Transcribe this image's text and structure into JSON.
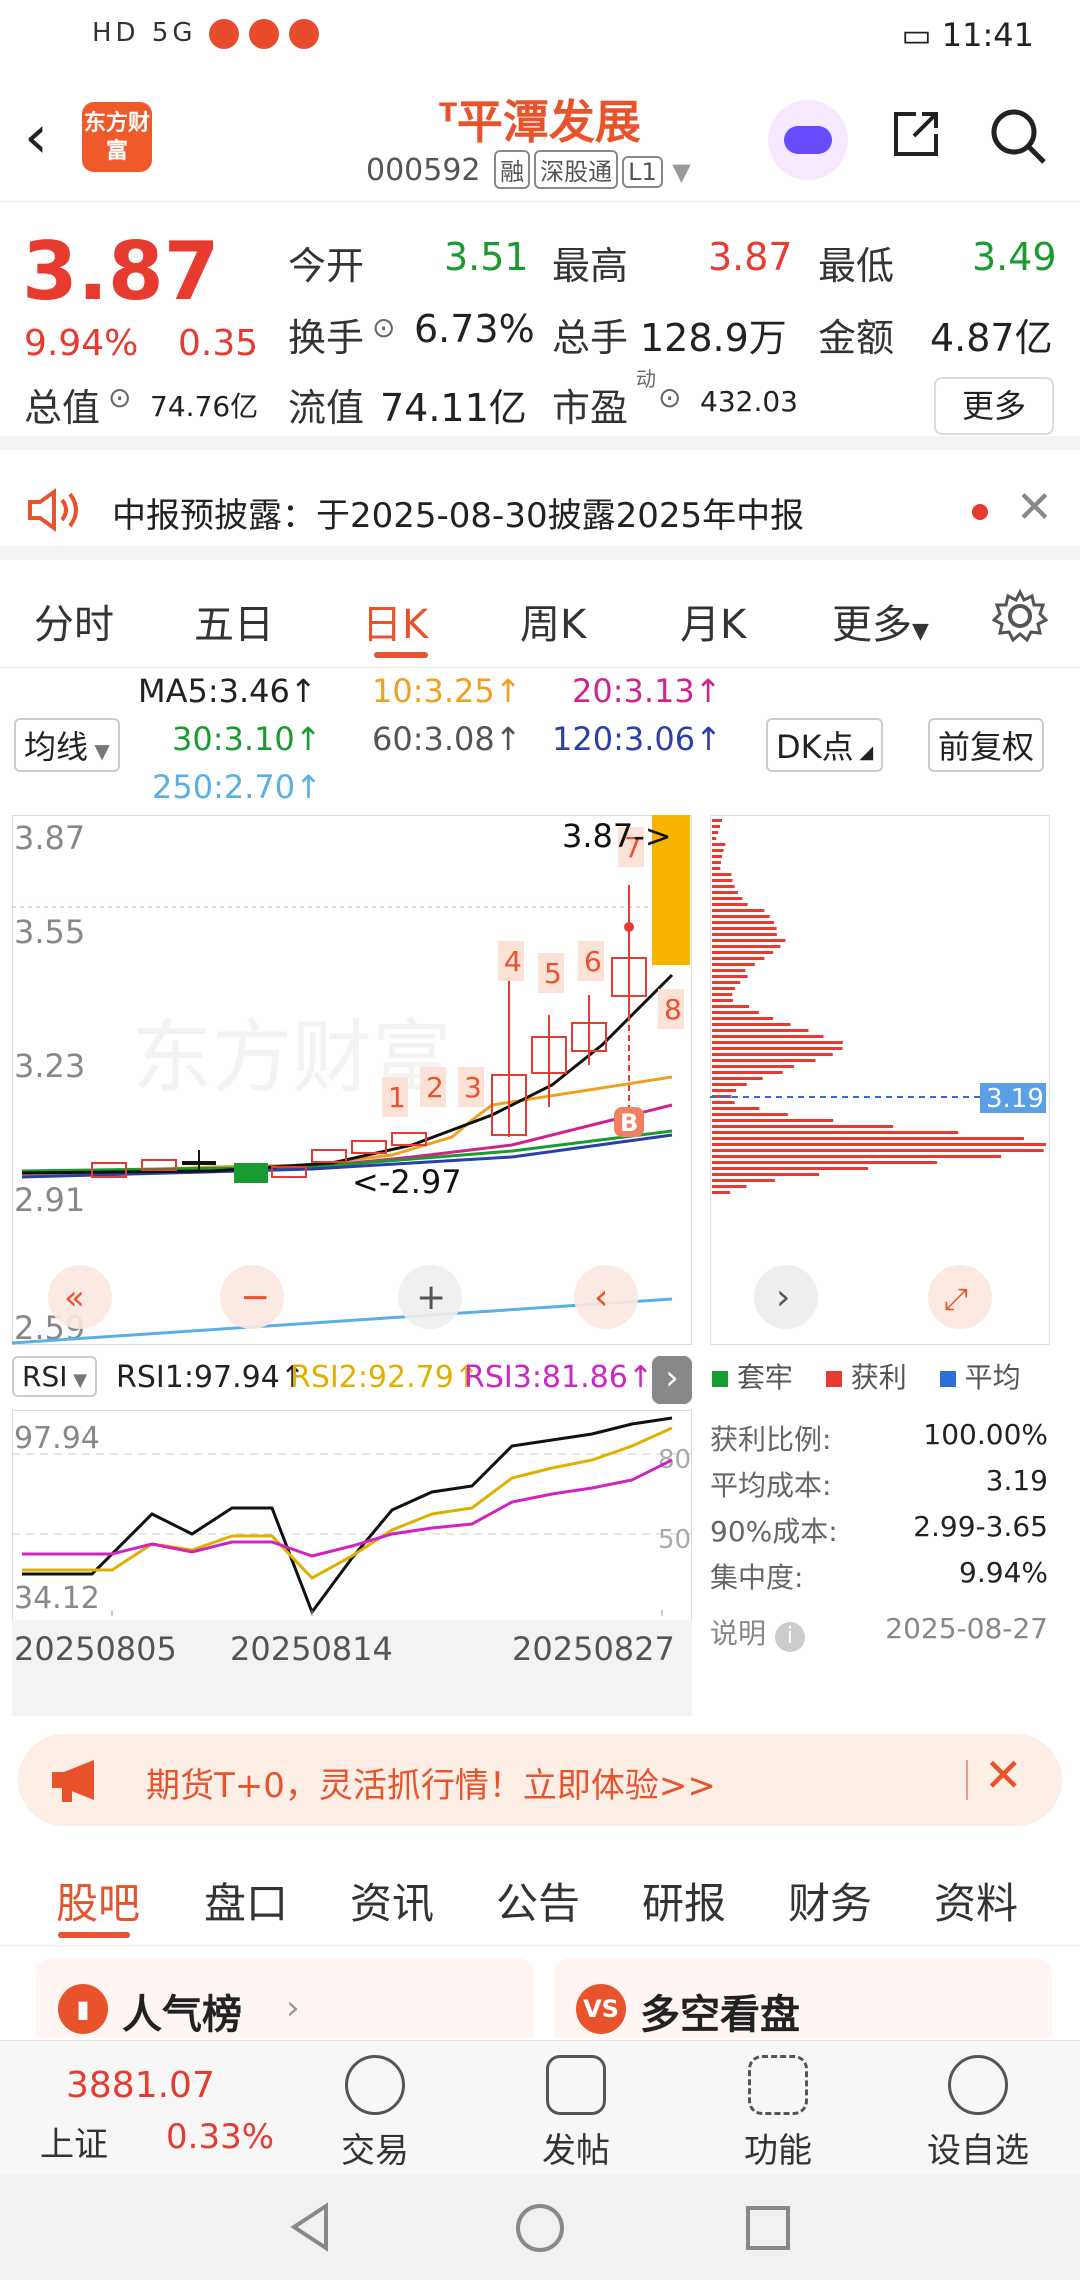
{
  "status_bar": {
    "left_text": "HD 5G",
    "time": "11:41"
  },
  "header": {
    "logo": "东方财富",
    "title_prefix": "T",
    "title": "平潭发展",
    "code": "000592",
    "tags": [
      "融",
      "深股通",
      "L1"
    ]
  },
  "quote": {
    "price": "3.87",
    "pct": "9.94%",
    "change": "0.35",
    "rows": [
      [
        {
          "label": "今开",
          "value": "3.51",
          "color": "green"
        },
        {
          "label": "最高",
          "value": "3.87",
          "color": "red"
        },
        {
          "label": "最低",
          "value": "3.49",
          "color": "green"
        }
      ],
      [
        {
          "label": "换手",
          "value": "6.73%",
          "color": "black"
        },
        {
          "label": "总手",
          "value": "128.9万",
          "color": "black"
        },
        {
          "label": "金额",
          "value": "4.87亿",
          "color": "black"
        }
      ]
    ],
    "total_value_label": "总值",
    "total_value": "74.76亿",
    "float_value_label": "流值",
    "float_value": "74.11亿",
    "pe_label": "市盈",
    "pe_sup": "动",
    "pe_value": "432.03",
    "more": "更多"
  },
  "notice": {
    "text": "中报预披露：于2025-08-30披露2025年中报"
  },
  "periods": {
    "tabs": [
      "分时",
      "五日",
      "日K",
      "周K",
      "月K",
      "更多"
    ],
    "active": "日K"
  },
  "ma": {
    "selector": "均线",
    "items": [
      {
        "text": "MA5:3.46↑",
        "color": "#222222"
      },
      {
        "text": "10:3.25↑",
        "color": "#f0a020"
      },
      {
        "text": "20:3.13↑",
        "color": "#d0248c"
      },
      {
        "text": "30:3.10↑",
        "color": "#1a9b2f"
      },
      {
        "text": "60:3.08↑",
        "color": "#555555"
      },
      {
        "text": "120:3.06↑",
        "color": "#2a3fa8"
      },
      {
        "text": "250:2.70↑",
        "color": "#5ab0e6"
      }
    ],
    "dk_button": "DK点",
    "adjust_button": "前复权"
  },
  "kline": {
    "y_labels": [
      "3.87",
      "3.55",
      "3.23",
      "2.91",
      "2.59"
    ],
    "high_marker": "3.87->",
    "low_marker": "<-2.97",
    "watermark": "东方财富",
    "signals": [
      "1",
      "2",
      "3",
      "4",
      "5",
      "6",
      "7",
      "8"
    ],
    "buy_marker": "B"
  },
  "volume_profile": {
    "avg_line_label": "3.19"
  },
  "rsi": {
    "selector": "RSI",
    "rsi1": "RSI1:97.94↑",
    "rsi2": "RSI2:92.79↑",
    "rsi3": "RSI3:81.86↑",
    "top_label": "97.94",
    "bottom_label": "34.12",
    "line80": "80",
    "line50": "50",
    "dates": [
      "20250805",
      "20250814",
      "20250827"
    ]
  },
  "cost": {
    "legend": [
      {
        "label": "套牢",
        "color": "#1a9b2f"
      },
      {
        "label": "获利",
        "color": "#e63b2e"
      },
      {
        "label": "平均",
        "color": "#2a6fd8"
      }
    ],
    "rows": [
      {
        "label": "获利比例:",
        "value": "100.00%"
      },
      {
        "label": "平均成本:",
        "value": "3.19"
      },
      {
        "label": "90%成本:",
        "value": "2.99-3.65"
      },
      {
        "label": "集中度:",
        "value": "9.94%"
      }
    ],
    "note": "说明",
    "date": "2025-08-27"
  },
  "promo": {
    "text": "期货T+0，灵活抓行情！立即体验>>"
  },
  "content_tabs": {
    "tabs": [
      "股吧",
      "盘口",
      "资讯",
      "公告",
      "研报",
      "财务",
      "资料"
    ],
    "active": "股吧"
  },
  "cards": [
    {
      "label": "人气榜"
    },
    {
      "label": "多空看盘"
    }
  ],
  "bottom_nav": {
    "index_value": "3881.07",
    "index_name": "上证",
    "index_pct": "0.33%",
    "items": [
      "交易",
      "发帖",
      "功能",
      "设自选"
    ]
  }
}
